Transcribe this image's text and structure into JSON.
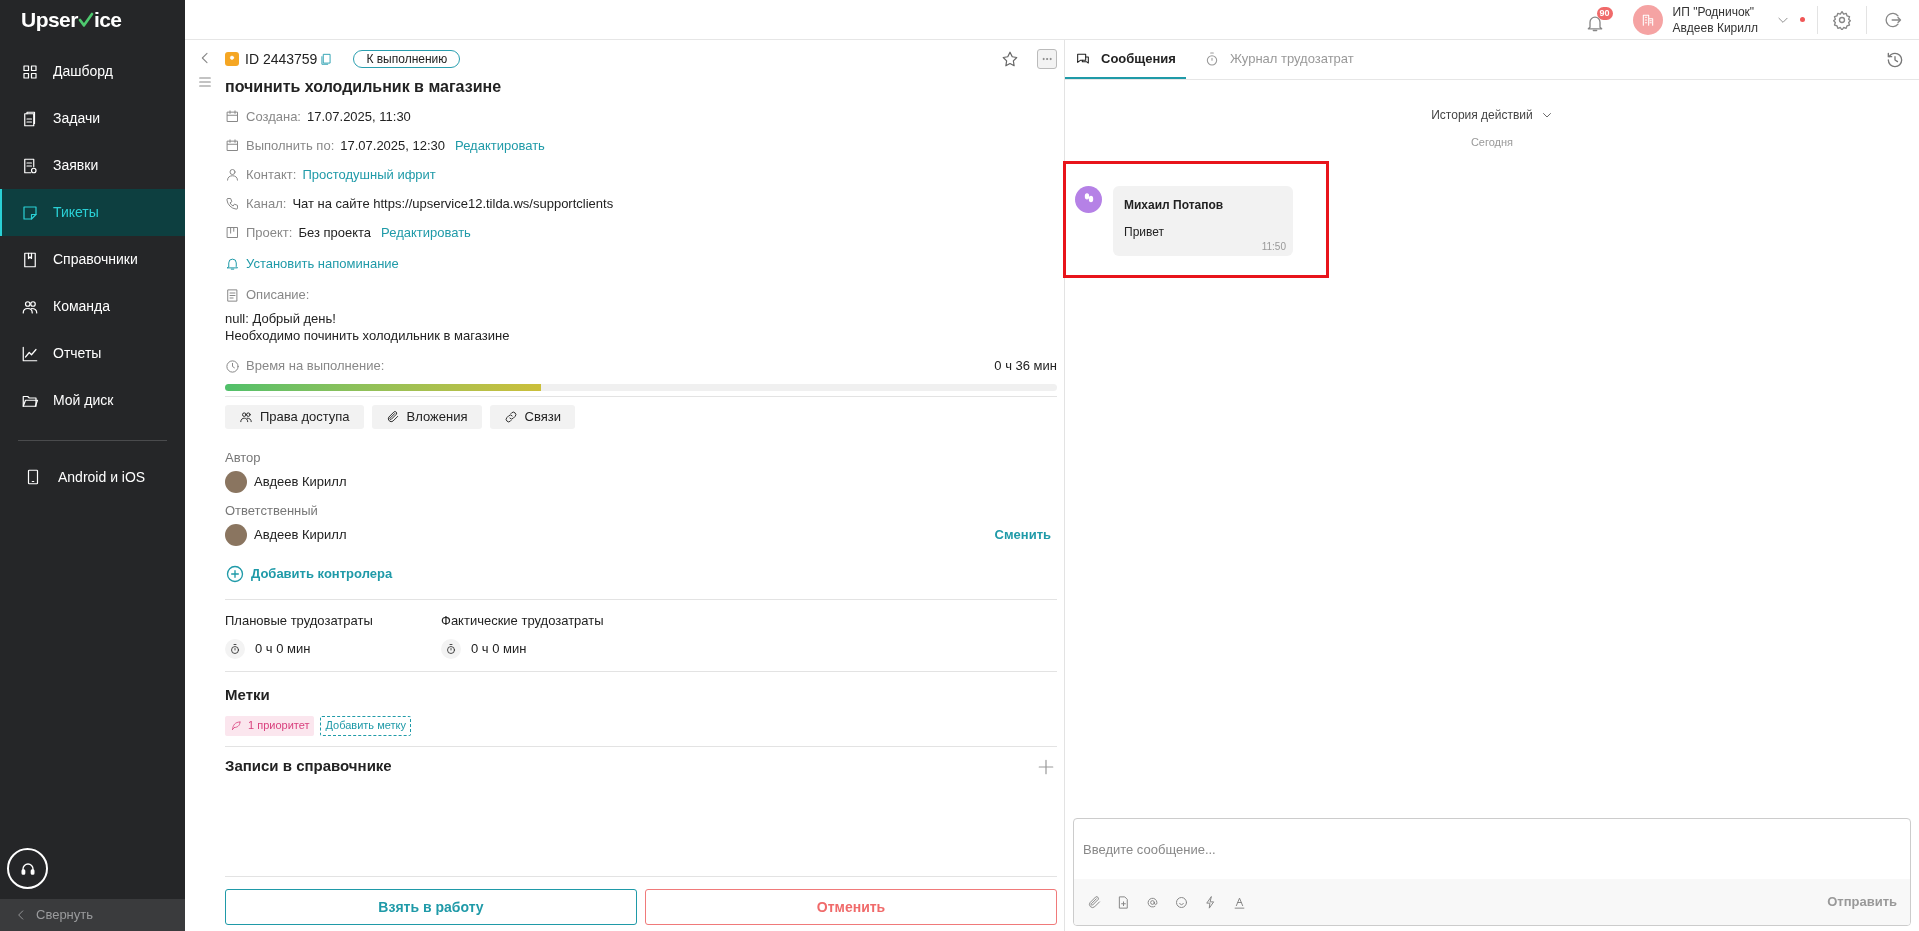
{
  "logo": {
    "before": "Upser",
    "after": "ice"
  },
  "sidebar": {
    "items": [
      {
        "label": "Дашборд",
        "selected": false
      },
      {
        "label": "Задачи",
        "selected": false
      },
      {
        "label": "Заявки",
        "selected": false
      },
      {
        "label": "Тикеты",
        "selected": true
      },
      {
        "label": "Справочники",
        "selected": false
      },
      {
        "label": "Команда",
        "selected": false
      },
      {
        "label": "Отчеты",
        "selected": false
      },
      {
        "label": "Мой диск",
        "selected": false
      }
    ],
    "mobile": "Android и iOS",
    "collapse": "Свернуть"
  },
  "header": {
    "notifications": "90",
    "org": "ИП \"Родничок\"",
    "user": "Авдеев Кирилл"
  },
  "ticket": {
    "id": "ID 2443759",
    "status": "К выполнению",
    "title": "починить холодильник в магазине",
    "fields": [
      {
        "label": "Создана:",
        "value": "17.07.2025, 11:30",
        "value_is_link": false
      },
      {
        "label": "Выполнить по:",
        "value": "17.07.2025, 12:30",
        "value_is_link": false,
        "action": "Редактировать"
      },
      {
        "label": "Контакт:",
        "value": "Простодушный ифрит",
        "value_is_link": true
      },
      {
        "label": "Канал:",
        "value": "Чат на сайте https://upservice12.tilda.ws/supportclients",
        "value_is_link": false
      },
      {
        "label": "Проект:",
        "value": "Без проекта",
        "value_is_link": false,
        "action": "Редактировать"
      }
    ],
    "reminder": "Установить напоминание",
    "description": {
      "label": "Описание:",
      "lines": [
        "null: Добрый день!",
        "Необходимо починить холодильник в магазине"
      ]
    },
    "time": {
      "label": "Время на выполнение:",
      "value": "0 ч 36 мин",
      "level": 0.38
    },
    "buttons": [
      "Права доступа",
      "Вложения",
      "Связи"
    ],
    "people": [
      {
        "role": "Автор",
        "name": "Авдеев Кирилл"
      },
      {
        "role": "Ответственный",
        "name": "Авдеев Кирилл",
        "action": "Сменить"
      }
    ],
    "add_controller": "Добавить контролера",
    "efforts": [
      {
        "label": "Плановые трудозатраты",
        "value": "0 ч 0 мин"
      },
      {
        "label": "Фактические трудозатраты",
        "value": "0 ч 0 мин"
      }
    ],
    "tags": {
      "title": "Метки",
      "items": [
        {
          "label": "1 приоритет",
          "color": "#d9417e"
        }
      ],
      "add": "Добавить метку"
    },
    "directory": {
      "title": "Записи в справочнике"
    },
    "actions": [
      {
        "label": "Взять в работу",
        "kind": "primary"
      },
      {
        "label": "Отменить",
        "kind": "danger"
      }
    ]
  },
  "chat": {
    "tabs": [
      {
        "label": "Сообщения",
        "selected": true
      },
      {
        "label": "Журнал трудозатрат",
        "selected": false
      }
    ],
    "history": "История действий",
    "day": "Сегодня",
    "messages": [
      {
        "author": "Михаил Потапов",
        "text": "Привет",
        "time": "11:50",
        "highlighted": true
      }
    ],
    "composer": {
      "placeholder": "Введите сообщение...",
      "send": "Отправить"
    }
  }
}
